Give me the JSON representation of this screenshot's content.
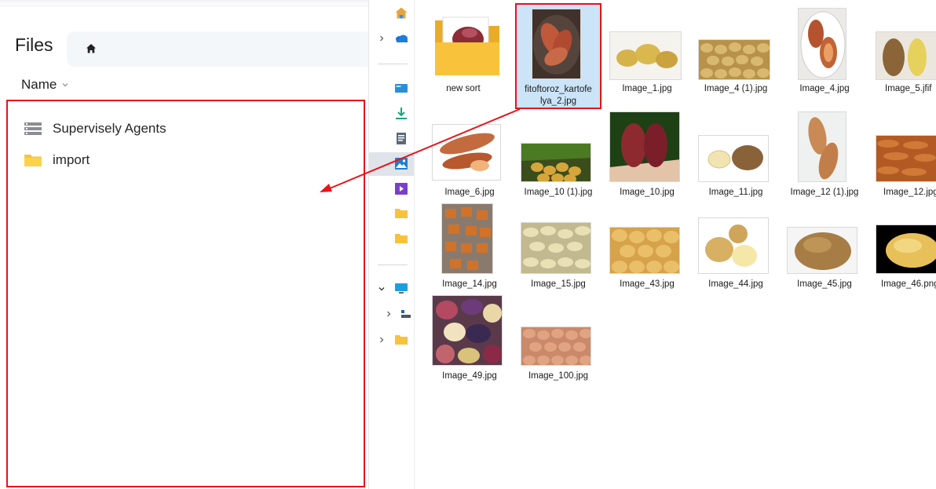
{
  "web_panel": {
    "title": "Files",
    "sort_label": "Name",
    "items": [
      {
        "name": "Supervisely Agents",
        "icon": "server-icon"
      },
      {
        "name": "import",
        "icon": "folder-icon"
      }
    ]
  },
  "explorer": {
    "nav_icons": [
      "home-icon",
      "onedrive-cloud-icon",
      "desktop-icon",
      "downloads-icon",
      "documents-icon",
      "pictures-icon",
      "videos-icon",
      "folder-icon",
      "folder-icon",
      "this-pc-icon",
      "network-drive-icon",
      "folder-icon"
    ],
    "files": [
      {
        "name": "new sort"
      },
      {
        "name": "fitoftoroz_kartofelya_2.jpg",
        "line1": "fitoftoroz_kartofe",
        "line2": "lya_2.jpg",
        "selected": true
      },
      {
        "name": "Image_1.jpg"
      },
      {
        "name": "Image_4 (1).jpg"
      },
      {
        "name": "Image_4.jpg"
      },
      {
        "name": "Image_5.jfif"
      },
      {
        "name": "Image_6.jpg"
      },
      {
        "name": "Image_10 (1).jpg"
      },
      {
        "name": "Image_10.jpg"
      },
      {
        "name": "Image_11.jpg"
      },
      {
        "name": "Image_12 (1).jpg"
      },
      {
        "name": "Image_12.jpg"
      },
      {
        "name": "Image_14.jpg"
      },
      {
        "name": "Image_15.jpg"
      },
      {
        "name": "Image_43.jpg"
      },
      {
        "name": "Image_44.jpg"
      },
      {
        "name": "Image_45.jpg"
      },
      {
        "name": "Image_46.png"
      },
      {
        "name": "Image_49.jpg"
      },
      {
        "name": "Image_100.jpg"
      }
    ]
  },
  "colors": {
    "highlight_red": "#e8141a",
    "selection_blue": "#cce4f7",
    "folder_yellow": "#f8c33b"
  }
}
